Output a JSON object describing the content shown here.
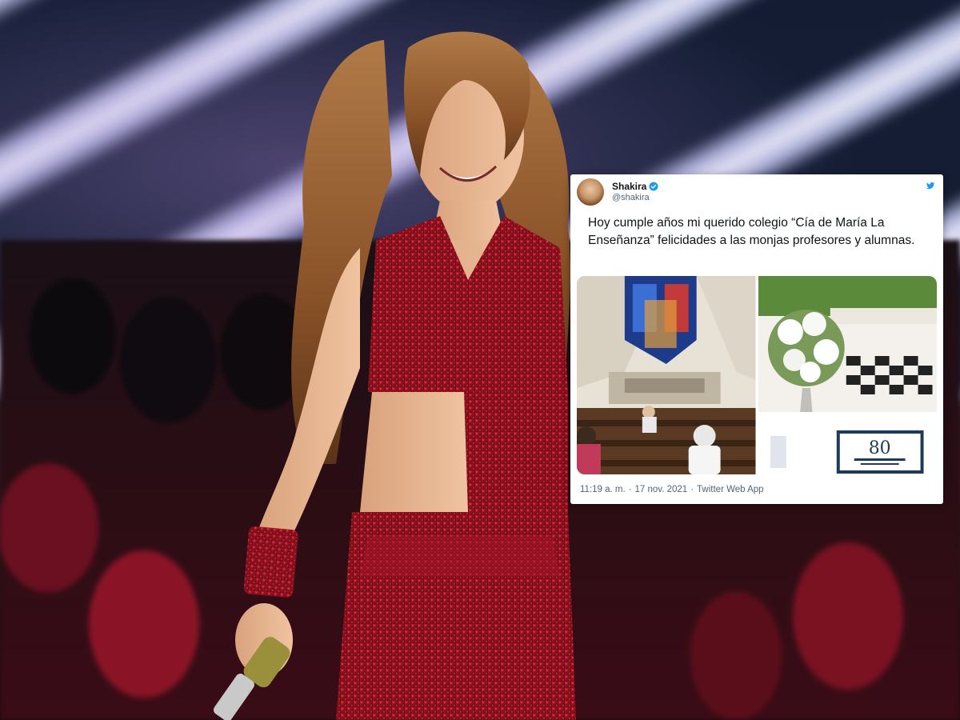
{
  "tweet": {
    "author_name": "Shakira",
    "handle": "@shakira",
    "text": "Hoy cumple años mi querido colegio “Cía de María La Enseñanza” felicidades a las monjas profesores y alumnas.",
    "timestamp_time": "11:19 a. m.",
    "separator": "·",
    "timestamp_date": "17 nov. 2021",
    "source": "Twitter Web App",
    "cake_number": "80"
  },
  "icons": {
    "verified": "verified-badge-icon",
    "twitter": "twitter-bird-icon"
  },
  "colors": {
    "verified_blue": "#1d9bf0",
    "dress_red": "#8c0f1c",
    "tweet_text": "#0f1419",
    "muted_text": "#536471"
  }
}
